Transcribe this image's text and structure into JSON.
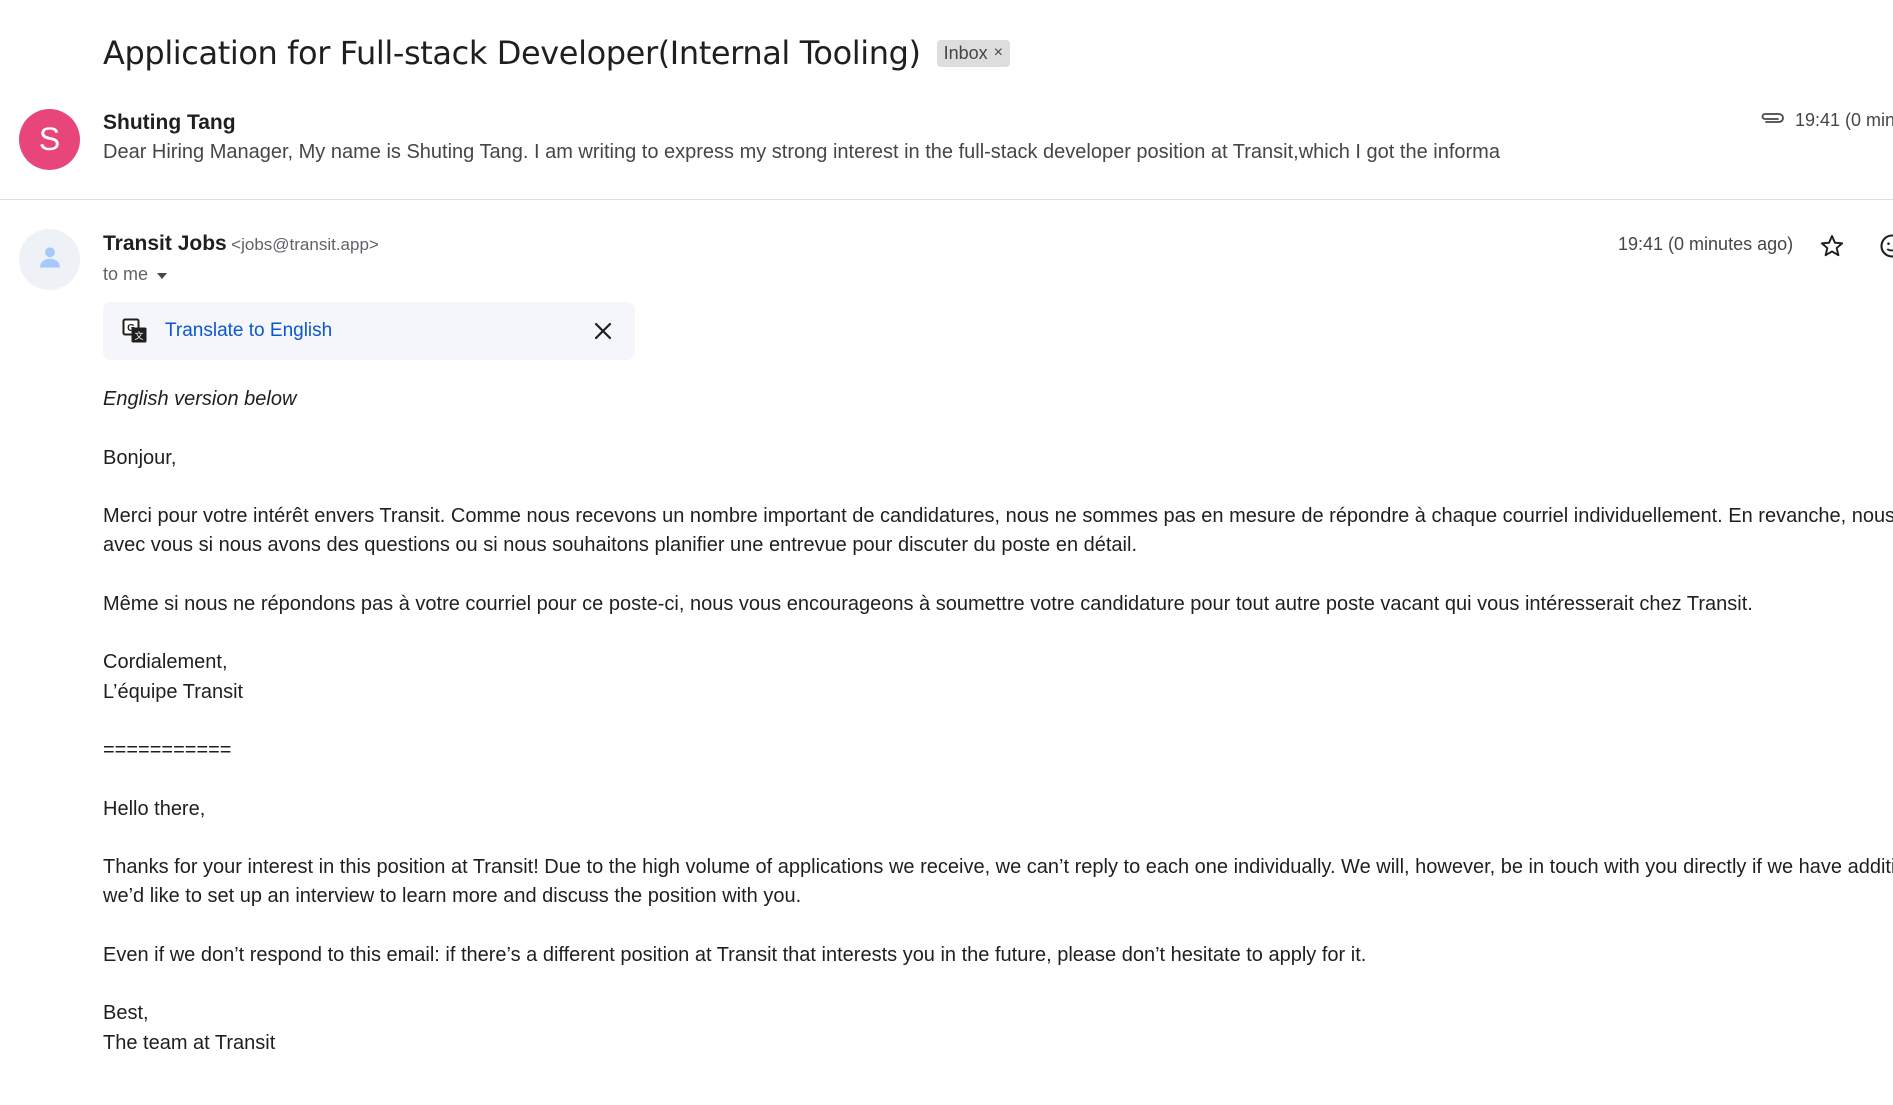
{
  "thread": {
    "subject": "Application for Full-stack Developer(Internal Tooling)",
    "label": "Inbox",
    "label_remove": "×"
  },
  "message1": {
    "avatar_letter": "S",
    "avatar_color": "#e8457a",
    "sender": "Shuting Tang",
    "snippet": "Dear Hiring Manager, My name is Shuting Tang. I am writing to express my strong interest in the full-stack developer position at Transit,which I got the informa",
    "time": "19:41 (0 min",
    "attachment_icon": "paperclip-icon"
  },
  "message2": {
    "sender_name": "Transit Jobs",
    "sender_email": "<jobs@transit.app>",
    "to": "to me",
    "time": "19:41 (0 minutes ago)",
    "translate_label": "Translate to English",
    "body": {
      "intro": "English version below",
      "fr_greeting": "Bonjour,",
      "fr_p1_line1": "Merci pour votre intérêt envers Transit. Comme nous recevons un nombre important de candidatures, nous ne sommes pas en mesure de répondre à chaque courriel individuellement. En revanche, nous com",
      "fr_p1_line2": "avec vous si nous avons des questions ou si nous souhaitons planifier une entrevue pour discuter du poste en détail.",
      "fr_p2": "Même si nous ne répondons pas à votre courriel pour ce poste-ci, nous vous encourageons à soumettre votre candidature pour tout autre poste vacant qui vous intéresserait chez Transit.",
      "fr_signoff": "Cordialement,",
      "fr_team": "L’équipe Transit",
      "separator": "===========",
      "en_greeting": "Hello there,",
      "en_p1_line1": "Thanks for your interest in this position at Transit! Due to the high volume of applications we receive, we can’t reply to each one individually. We will, however, be in touch with you directly if we have additional",
      "en_p1_line2": "we’d like to set up an interview to learn more and discuss the position with you.",
      "en_p2": "Even if we don’t respond to this email: if there’s a different position at Transit that interests you in the future, please don’t hesitate to apply for it.",
      "en_signoff": "Best,",
      "en_team": "The team at Transit"
    }
  },
  "colors": {
    "link": "#0b57d0",
    "translate_bg": "#f4f6fc",
    "chip_bg": "#dddddd"
  }
}
